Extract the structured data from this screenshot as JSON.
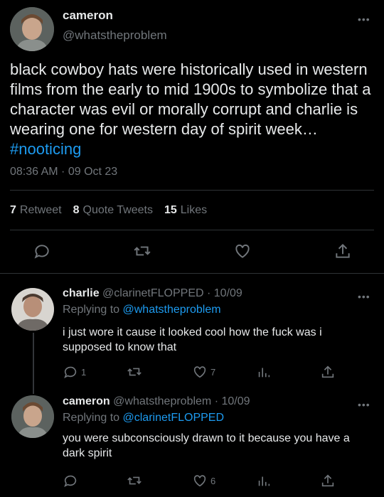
{
  "main_tweet": {
    "display_name": "cameron",
    "handle": "@whatstheproblem",
    "text": "black cowboy hats were historically used in western films from the early to mid 1900s to symbolize that a character was evil or morally corrupt and charlie is wearing one for western day of spirit week… ",
    "hashtag": "#nooticing",
    "timestamp": "08:36 AM · 09 Oct 23",
    "stats": {
      "retweets_count": "7",
      "retweets_label": "Retweet",
      "quotes_count": "8",
      "quotes_label": "Quote Tweets",
      "likes_count": "15",
      "likes_label": "Likes"
    },
    "more": "•••"
  },
  "replies": [
    {
      "display_name": "charlie",
      "meta": "@clarinetFLOPPED · 10/09",
      "replying_prefix": "Replying to ",
      "replying_to": "@whatstheproblem",
      "text": "i just wore it cause it looked cool how the fuck was i supposed to know that",
      "reply_count": "1",
      "like_count": "7",
      "more": "•••"
    },
    {
      "display_name": "cameron",
      "meta": "@whatstheproblem · 10/09",
      "replying_prefix": "Replying to ",
      "replying_to": "@clarinetFLOPPED",
      "text": "you were subconsciously drawn to it because you have a dark spirit",
      "reply_count": "",
      "like_count": "6",
      "more": "•••"
    }
  ],
  "icons": [
    "reply-icon",
    "retweet-icon",
    "like-icon",
    "share-icon",
    "analytics-icon",
    "more-icon"
  ],
  "colors": {
    "background": "#000000",
    "text": "#e7e9ea",
    "muted": "#71767b",
    "link": "#1d9bf0",
    "divider": "#2f3336"
  }
}
